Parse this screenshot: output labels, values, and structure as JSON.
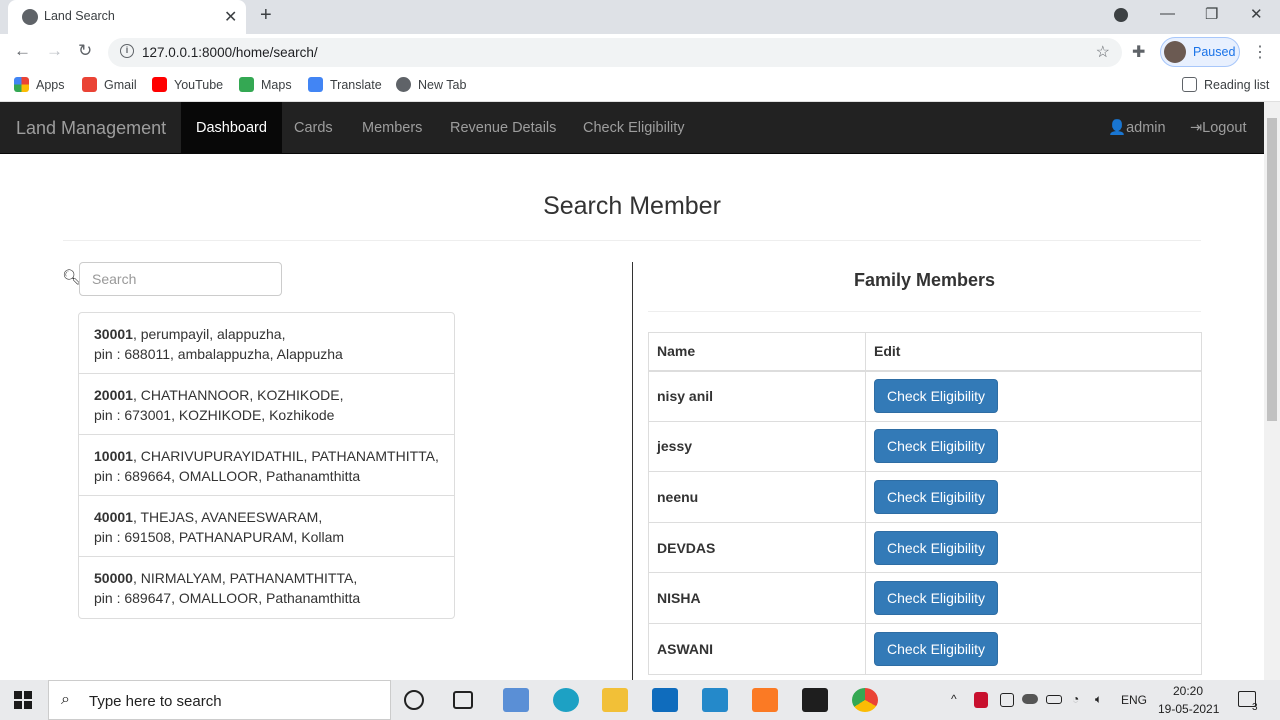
{
  "browser": {
    "tab_title": "Land Search",
    "url": "127.0.0.1:8000/home/search/",
    "profile_status": "Paused",
    "bookmarks": [
      {
        "label": "Apps",
        "icon": "apps-grid-icon"
      },
      {
        "label": "Gmail",
        "icon": "gmail-icon"
      },
      {
        "label": "YouTube",
        "icon": "youtube-icon"
      },
      {
        "label": "Maps",
        "icon": "maps-icon"
      },
      {
        "label": "Translate",
        "icon": "translate-icon"
      },
      {
        "label": "New Tab",
        "icon": "globe-icon"
      }
    ],
    "reading_list": "Reading list"
  },
  "navbar": {
    "brand": "Land Management",
    "links": [
      "Dashboard",
      "Cards",
      "Members",
      "Revenue Details",
      "Check Eligibility"
    ],
    "active": "Dashboard",
    "user": "admin",
    "logout": "Logout"
  },
  "page": {
    "title": "Search Member",
    "search_placeholder": "Search"
  },
  "members": [
    {
      "id": "30001",
      "line1": ", perumpayil, alappuzha,",
      "line2": "pin : 688011, ambalappuzha, Alappuzha"
    },
    {
      "id": "20001",
      "line1": ", CHATHANNOOR, KOZHIKODE,",
      "line2": "pin : 673001, KOZHIKODE, Kozhikode"
    },
    {
      "id": "10001",
      "line1": ", CHARIVUPURAYIDATHIL, PATHANAMTHITTA,",
      "line2": "pin : 689664, OMALLOOR, Pathanamthitta"
    },
    {
      "id": "40001",
      "line1": ", THEJAS, AVANEESWARAM,",
      "line2": "pin : 691508, PATHANAPURAM, Kollam"
    },
    {
      "id": "50000",
      "line1": ", NIRMALYAM, PATHANAMTHITTA,",
      "line2": "pin : 689647, OMALLOOR, Pathanamthitta"
    }
  ],
  "family": {
    "title": "Family Members",
    "columns": [
      "Name",
      "Edit"
    ],
    "button_label": "Check Eligibility",
    "rows": [
      "nisy anil",
      "jessy",
      "neenu",
      "DEVDAS",
      "NISHA",
      "ASWANI"
    ]
  },
  "taskbar": {
    "search_placeholder": "Type here to search",
    "language": "ENG",
    "time": "20:20",
    "date": "19-05-2021",
    "notifications": "3"
  },
  "colors": {
    "navbar_bg": "#222222",
    "primary_button": "#337ab7"
  }
}
